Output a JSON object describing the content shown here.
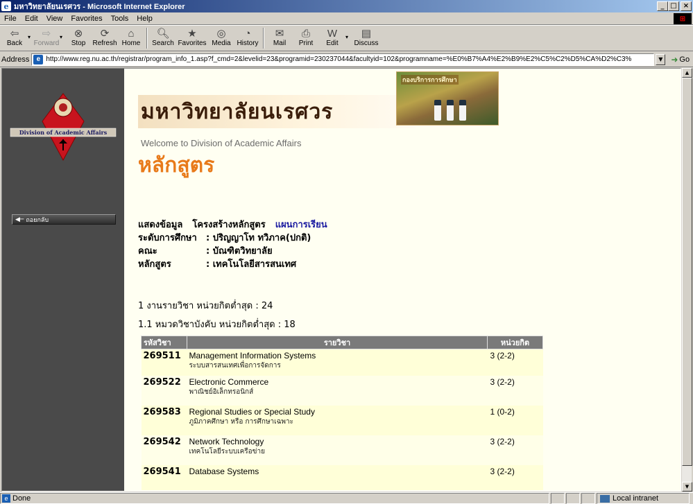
{
  "window": {
    "title": "มหาวิทยาลัยนเรศวร - Microsoft Internet Explorer",
    "buttons": {
      "minimize": "_",
      "maximize": "□",
      "close": "×"
    }
  },
  "menu": [
    "File",
    "Edit",
    "View",
    "Favorites",
    "Tools",
    "Help"
  ],
  "toolbar": {
    "back": "Back",
    "forward": "Forward",
    "stop": "Stop",
    "refresh": "Refresh",
    "home": "Home",
    "search": "Search",
    "favorites": "Favorites",
    "media": "Media",
    "history": "History",
    "mail": "Mail",
    "print": "Print",
    "edit": "Edit",
    "discuss": "Discuss"
  },
  "address": {
    "label": "Address",
    "url": "http://www.reg.nu.ac.th/registrar/program_info_1.asp?f_cmd=2&levelid=23&programid=230237044&facultyid=102&programname=%E0%B7%A4%E2%B9%E2%C5%C2%D5%CA%D2%C3%",
    "go": "Go"
  },
  "sidebar": {
    "logo_text": "Division of Academic Affairs",
    "back_label": "ถอยกลับ"
  },
  "banner": {
    "title": "มหาวิทยาลัยนเรศวร",
    "subtitle": "Welcome to Division of Academic Affairs",
    "photo_label": "กองบริการการศึกษา"
  },
  "page": {
    "heading": "หลักสูตร",
    "links": [
      "แสดงข้อมูล",
      "โครงสร้างหลักสูตร",
      "แผนการเรียน"
    ],
    "info": [
      {
        "label": "ระดับการศึกษา",
        "value": ": ปริญญาโท ทวิภาค(ปกติ)"
      },
      {
        "label": "คณะ",
        "value": ": บัณฑิตวิทยาลัย"
      },
      {
        "label": "หลักสูตร",
        "value": ": เทคโนโลยีสารสนเทศ"
      }
    ],
    "group1": "1   งานรายวิชา หน่วยกิตต่ำสุด : 24",
    "group1_1": "1.1   หมวดวิชาบังคับ หน่วยกิตต่ำสุด : 18"
  },
  "table": {
    "headers": {
      "code": "รหัสวิชา",
      "name": "รายวิชา",
      "credit": "หน่วยกิต"
    },
    "rows": [
      {
        "code": "269511",
        "name_en": "Management Information Systems",
        "name_th": "ระบบสารสนเทศเพื่อการจัดการ",
        "credit": "3 (2-2)"
      },
      {
        "code": "269522",
        "name_en": "Electronic Commerce",
        "name_th": "พาณิชย์อิเล็กทรอนิกส์",
        "credit": "3 (2-2)"
      },
      {
        "code": "269583",
        "name_en": "Regional Studies or Special Study",
        "name_th": "ภูมิภาคศึกษา หรือ การศึกษาเฉพาะ",
        "credit": "1 (0-2)"
      },
      {
        "code": "269542",
        "name_en": "Network Technology",
        "name_th": "เทคโนโลยีระบบเครือข่าย",
        "credit": "3 (2-2)"
      },
      {
        "code": "269541",
        "name_en": "Database Systems",
        "name_th": "",
        "credit": "3 (2-2)"
      }
    ]
  },
  "status": {
    "text": "Done",
    "zone": "Local intranet"
  },
  "colors": {
    "heading_orange": "#e87a1a",
    "link_blue": "#1a1aa0",
    "sidebar_bg": "#4a4a4a",
    "table_header_bg": "#7a7a7a",
    "row_bg": "#ffffd8"
  }
}
